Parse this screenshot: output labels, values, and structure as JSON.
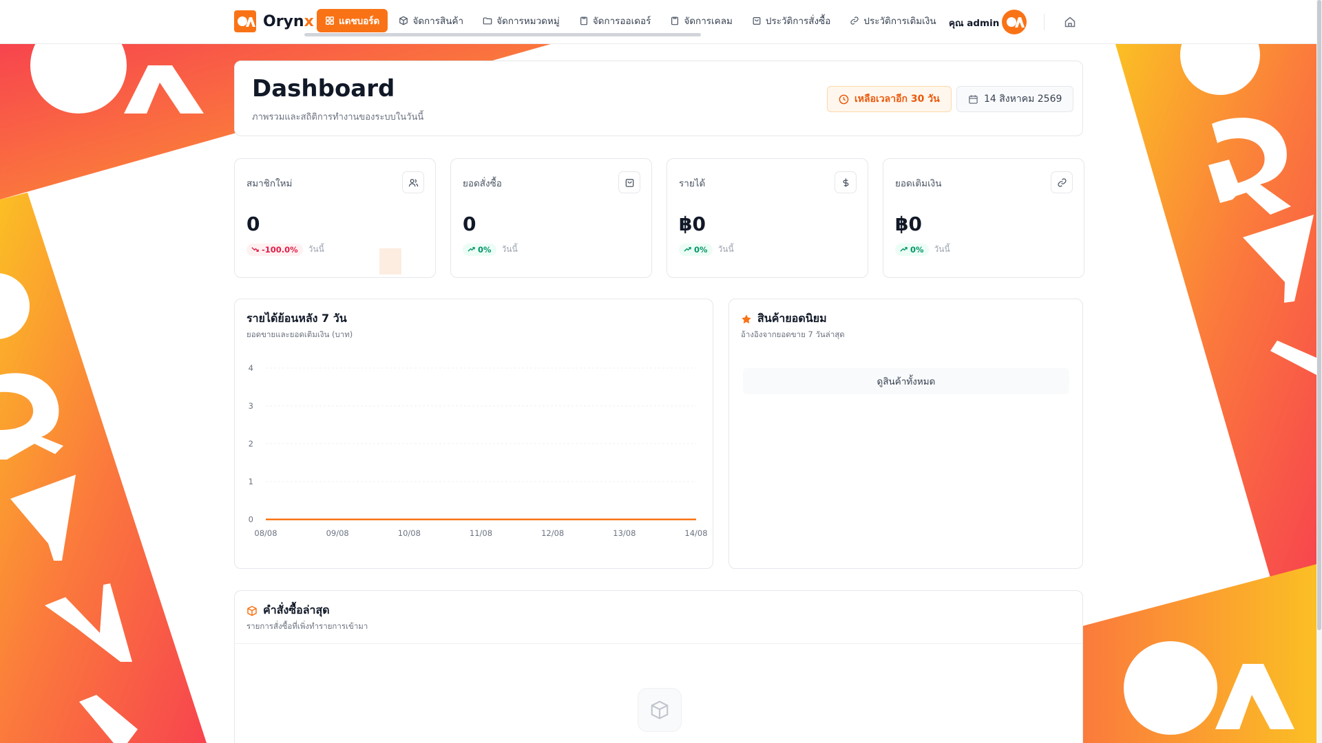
{
  "brand": {
    "name_main": "Oryn",
    "name_accent": "x",
    "accent_color": "#f97316"
  },
  "nav": {
    "items": [
      {
        "label": "แดชบอร์ด",
        "icon": "grid-icon",
        "active": true
      },
      {
        "label": "จัดการสินค้า",
        "icon": "box-icon",
        "active": false
      },
      {
        "label": "จัดการหมวดหมู่",
        "icon": "folder-icon",
        "active": false
      },
      {
        "label": "จัดการออเดอร์",
        "icon": "clipboard-icon",
        "active": false
      },
      {
        "label": "จัดการเคลม",
        "icon": "clipboard-icon",
        "active": false
      },
      {
        "label": "ประวัติการสั่งซื้อ",
        "icon": "bag-icon",
        "active": false
      },
      {
        "label": "ประวัติการเติมเงิน",
        "icon": "link-icon",
        "active": false
      }
    ],
    "user_name": "คุณ admin",
    "home_icon": "home-icon"
  },
  "header": {
    "title": "Dashboard",
    "subtitle": "ภาพรวมและสถิติการทำงานของระบบในวันนี้",
    "time_left": "เหลือเวลาอีก 30 วัน",
    "date": "14 สิงหาคม 2569"
  },
  "stats": [
    {
      "label": "สมาชิกใหม่",
      "icon": "users-icon",
      "value": "0",
      "change": "-100.0%",
      "trend": "down",
      "period": "วันนี้"
    },
    {
      "label": "ยอดสั่งซื้อ",
      "icon": "bag-icon",
      "value": "0",
      "change": "0%",
      "trend": "up",
      "period": "วันนี้"
    },
    {
      "label": "รายได้",
      "icon": "dollar-icon",
      "value": "฿0",
      "change": "0%",
      "trend": "up",
      "period": "วันนี้"
    },
    {
      "label": "ยอดเติมเงิน",
      "icon": "link-icon",
      "value": "฿0",
      "change": "0%",
      "trend": "up",
      "period": "วันนี้"
    }
  ],
  "revenue_chart": {
    "title": "รายได้ย้อนหลัง 7 วัน",
    "subtitle": "ยอดขายและยอดเติมเงิน (บาท)"
  },
  "popular": {
    "title": "สินค้ายอดนิยม",
    "subtitle": "อ้างอิงจากยอดขาย 7 วันล่าสุด",
    "view_all": "ดูสินค้าทั้งหมด"
  },
  "orders": {
    "title": "คำสั่งซื้อล่าสุด",
    "subtitle": "รายการสั่งซื้อที่เพิ่งทำรายการเข้ามา"
  },
  "chart_data": {
    "type": "line",
    "x": [
      "08/08",
      "09/08",
      "10/08",
      "11/08",
      "12/08",
      "13/08",
      "14/08"
    ],
    "series": [
      {
        "values": [
          0,
          0,
          0,
          0,
          0,
          0,
          0
        ],
        "color": "#f97316"
      }
    ],
    "ylim": [
      0,
      4
    ],
    "yticks": [
      "0",
      "1",
      "2",
      "3",
      "4"
    ],
    "grid": true
  }
}
